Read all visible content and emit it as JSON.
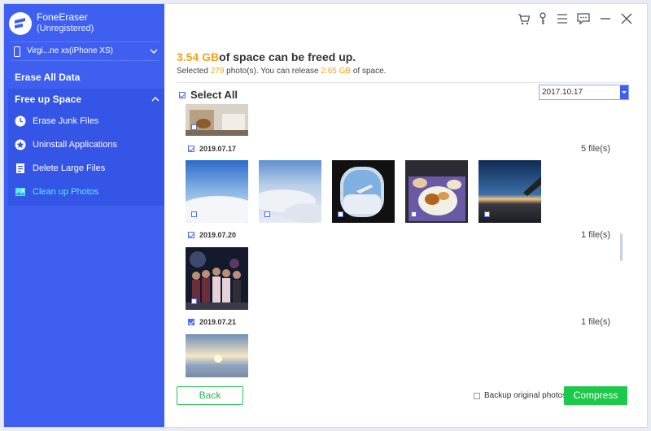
{
  "app": {
    "name": "FoneEraser",
    "status": "(Unregistered)"
  },
  "device": {
    "name": "Virgi...ne xs(iPhone XS)"
  },
  "sidebar": {
    "erase_all": "Erase All Data",
    "free_up": "Free up Space",
    "items": [
      {
        "label": "Erase Junk Files",
        "icon": "clock-icon"
      },
      {
        "label": "Uninstall Applications",
        "icon": "star-icon"
      },
      {
        "label": "Delete Large Files",
        "icon": "file-icon"
      },
      {
        "label": "Clean up Photos",
        "icon": "photo-icon",
        "active": true
      }
    ]
  },
  "toolbar": [
    "cart-icon",
    "key-icon",
    "menu-icon",
    "feedback-icon",
    "minimize-icon",
    "close-icon"
  ],
  "summary": {
    "amount": "3.54 GB",
    "headline_rest": "of space can be freed up.",
    "sub_prefix": "Selected ",
    "selected_count": "279",
    "sub_mid": " photo(s). You can release ",
    "release_amount": "2.65 GB",
    "sub_suffix": " of space."
  },
  "select_all": "Select All",
  "date_filter": "2017.10.17",
  "groups": [
    {
      "date": "2019.07.17",
      "count": "5 file(s)",
      "photos": 5
    },
    {
      "date": "2019.07.20",
      "count": "1 file(s)",
      "photos": 1
    },
    {
      "date": "2019.07.21",
      "count": "1 file(s)",
      "photos": 1
    }
  ],
  "footer": {
    "back": "Back",
    "backup_label": "Backup original photos",
    "compress": "Compress"
  },
  "colors": {
    "sidebar": "#3f5ff0",
    "accent": "#f6a21b",
    "compress": "#1ec84a"
  }
}
